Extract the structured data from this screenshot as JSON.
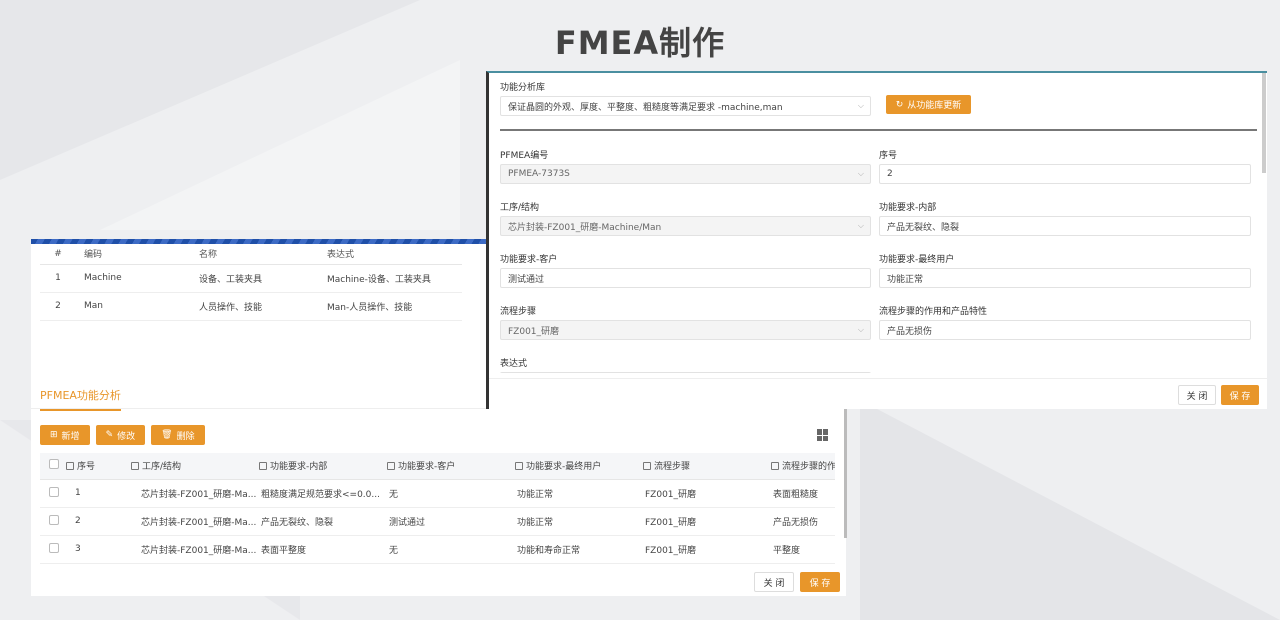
{
  "slide": {
    "title": "FMEA制作"
  },
  "code_table": {
    "headers": [
      "#",
      "编码",
      "名称",
      "表达式"
    ],
    "rows": [
      [
        "1",
        "Machine",
        "设备、工装夹具",
        "Machine-设备、工装夹具"
      ],
      [
        "2",
        "Man",
        "人员操作、技能",
        "Man-人员操作、技能"
      ]
    ]
  },
  "function_analysis": {
    "tab": "PFMEA功能分析",
    "toolbar": {
      "add": "新增",
      "edit": "修改",
      "delete": "删除"
    },
    "headers": [
      "序号",
      "工序/结构",
      "功能要求-内部",
      "功能要求-客户",
      "功能要求-最终用户",
      "流程步骤",
      "流程步骤的作"
    ],
    "rows": [
      [
        "1",
        "芯片封装-FZ001_研磨-Ma...",
        "粗糙度满足规范要求<=0.0...",
        "无",
        "功能正常",
        "FZ001_研磨",
        "表面粗糙度"
      ],
      [
        "2",
        "芯片封装-FZ001_研磨-Ma...",
        "产品无裂纹、隐裂",
        "测试通过",
        "功能正常",
        "FZ001_研磨",
        "产品无损伤"
      ],
      [
        "3",
        "芯片封装-FZ001_研磨-Ma...",
        "表面平整度",
        "无",
        "功能和寿命正常",
        "FZ001_研磨",
        "平整度"
      ]
    ],
    "close": "关 闭",
    "save": "保 存"
  },
  "form": {
    "library_label": "功能分析库",
    "library_value": "保证晶圆的外观、厚度、平整度、粗糙度等满足要求 -machine,man",
    "update_button": "从功能库更新",
    "pfmea_no_label": "PFMEA编号",
    "pfmea_no_value": "PFMEA-7373S",
    "seq_label": "序号",
    "seq_value": "2",
    "process_label": "工序/结构",
    "process_value": "芯片封装-FZ001_研磨-Machine/Man",
    "internal_label": "功能要求-内部",
    "internal_value": "产品无裂纹、隐裂",
    "customer_label": "功能要求-客户",
    "customer_value": "测试通过",
    "enduser_label": "功能要求-最终用户",
    "enduser_value": "功能正常",
    "step_label": "流程步骤",
    "step_value": "FZ001_研磨",
    "step_effect_label": "流程步骤的作用和产品特性",
    "step_effect_value": "产品无损伤",
    "expr_label": "表达式",
    "close": "关 闭",
    "save": "保 存"
  },
  "colors": {
    "accent": "#e8962a",
    "stripe": "#1f4fa8"
  }
}
